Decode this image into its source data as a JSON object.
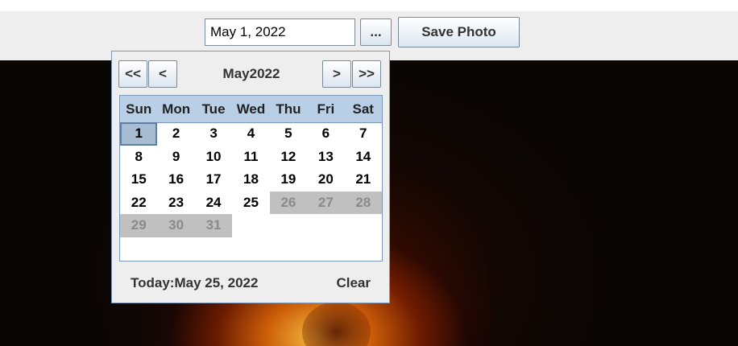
{
  "toolbar": {
    "date_value": "May 1, 2022",
    "browse_label": "...",
    "save_label": "Save Photo"
  },
  "calendar": {
    "nav": {
      "prev_year": "<<",
      "prev_month": "<",
      "next_month": ">",
      "next_year": ">>"
    },
    "month": "May",
    "year": "2022",
    "weekdays": [
      "Sun",
      "Mon",
      "Tue",
      "Wed",
      "Thu",
      "Fri",
      "Sat"
    ],
    "weeks": [
      [
        "1",
        "2",
        "3",
        "4",
        "5",
        "6",
        "7"
      ],
      [
        "8",
        "9",
        "10",
        "11",
        "12",
        "13",
        "14"
      ],
      [
        "15",
        "16",
        "17",
        "18",
        "19",
        "20",
        "21"
      ],
      [
        "22",
        "23",
        "24",
        "25",
        "26",
        "27",
        "28"
      ],
      [
        "29",
        "30",
        "31"
      ]
    ],
    "selected_day": "1",
    "disabled_days": [
      "26",
      "27",
      "28",
      "29",
      "30",
      "31"
    ],
    "today_label": "Today:",
    "today_value": "May 25, 2022",
    "clear_label": "Clear"
  },
  "colors": {
    "header_bg": "#b8cfe5",
    "selected_bg": "#a8bcd3",
    "disabled_bg": "#c0c0c0"
  }
}
